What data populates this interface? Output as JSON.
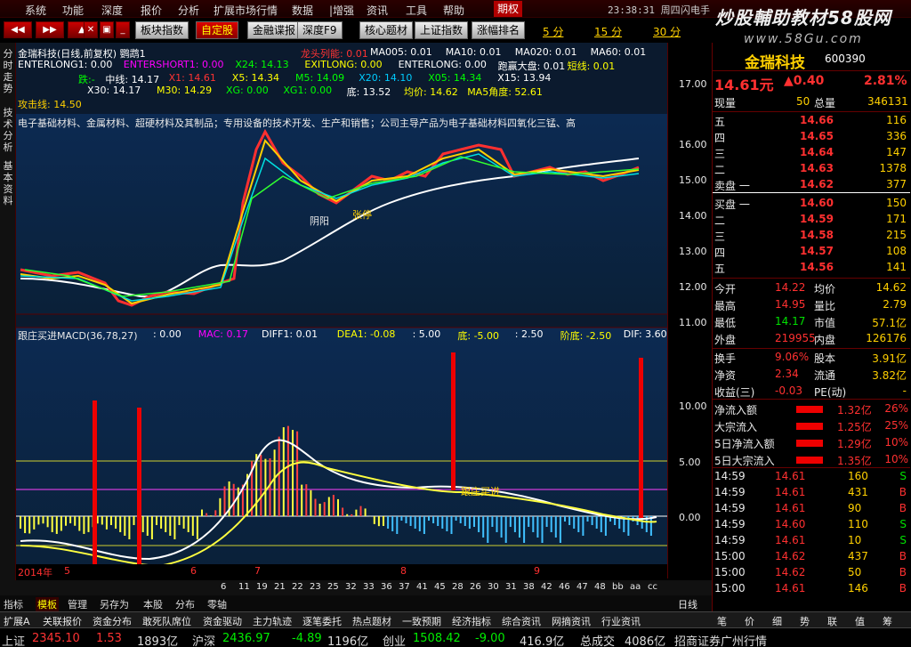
{
  "menu": {
    "items": [
      "系统",
      "功能",
      "深度",
      "报价",
      "分析",
      "扩展市场行情",
      "数据",
      "|增强",
      "资讯",
      "工具",
      "帮助"
    ],
    "active": "期权",
    "clock": "23:38:31 周四",
    "extra": "闪电手"
  },
  "brand": {
    "title": "炒股輔助教材58股网",
    "url": "www.58Gu.com"
  },
  "toolbar": {
    "buttons": [
      "板块指数",
      "自定股",
      "金融谍报",
      "深度F9",
      "核心题材",
      "上证指数",
      "涨幅排名"
    ],
    "periods": [
      "5 分",
      "15 分",
      "30 分"
    ]
  },
  "left_tabs": [
    "分时走势",
    "技术分析",
    "基本资料"
  ],
  "chart": {
    "title": "金瑞科技(日线,前复权) 鹦鹉1",
    "line1": [
      {
        "t": "ENTERLONG1: 0.00",
        "c": "#fff"
      },
      {
        "t": "ENTERSHORT1: 0.00",
        "c": "#f0f"
      },
      {
        "t": "X24: 14.13",
        "c": "#0f0"
      },
      {
        "t": "EXITLONG: 0.00",
        "c": "#ff0"
      },
      {
        "t": "ENTERLONG: 0.00",
        "c": "#fff"
      },
      {
        "t": "跑赢大盘: 0.01",
        "c": "#fff"
      },
      {
        "t": "短线: 0.01",
        "c": "#ff0"
      }
    ],
    "line0": [
      {
        "t": "龙头列能: 0.01",
        "c": "#f33"
      },
      {
        "t": "MA005: 0.01",
        "c": "#fff"
      },
      {
        "t": "MA10: 0.01",
        "c": "#fff"
      },
      {
        "t": "MA020: 0.01",
        "c": "#fff"
      },
      {
        "t": "MA60: 0.01",
        "c": "#fff"
      }
    ],
    "line2": [
      {
        "t": "跌:-",
        "c": "#0f0"
      },
      {
        "t": "中线: 14.17",
        "c": "#fff"
      },
      {
        "t": "X1: 14.61",
        "c": "#f33"
      },
      {
        "t": "X5: 14.34",
        "c": "#ff0"
      },
      {
        "t": "M5: 14.09",
        "c": "#0f0"
      },
      {
        "t": "X20: 14.10",
        "c": "#0cf"
      },
      {
        "t": "X05: 14.34",
        "c": "#0f0"
      },
      {
        "t": "X15: 13.94",
        "c": "#fff"
      }
    ],
    "line3": [
      {
        "t": "X30: 14.17",
        "c": "#fff"
      },
      {
        "t": "M30: 14.29",
        "c": "#ff0"
      },
      {
        "t": "XG: 0.00",
        "c": "#0f0"
      },
      {
        "t": "XG1: 0.00",
        "c": "#0f0"
      },
      {
        "t": "底: 13.52",
        "c": "#fff"
      },
      {
        "t": "均价: 14.62",
        "c": "#ff0"
      },
      {
        "t": "MA5角度: 52.61",
        "c": "#ff0"
      }
    ],
    "attack": "攻击线: 14.50",
    "ticker": "电子基础材料、金属材料、超硬材料及其制品；专用设备的技术开发、生产和销售；公司主导产品为电子基础材料四氧化三锰、高",
    "price_ticks": [
      "17.00",
      "16.00",
      "15.00",
      "14.00",
      "13.00",
      "12.00",
      "11.00"
    ],
    "macd_title": "跟庄买进MACD(36,78,27)",
    "macd_vals": [
      {
        "t": ": 0.00",
        "c": "#fff"
      },
      {
        "t": "MAC: 0.17",
        "c": "#f0f"
      },
      {
        "t": "DIFF1: 0.01",
        "c": "#fff"
      },
      {
        "t": "DEA1: -0.08",
        "c": "#ff0"
      },
      {
        "t": ": 5.00",
        "c": "#fff"
      },
      {
        "t": "底: -5.00",
        "c": "#ff0"
      },
      {
        "t": ": 2.50",
        "c": "#fff"
      },
      {
        "t": "阶底: -2.50",
        "c": "#ff0"
      },
      {
        "t": "DIF: 3.60",
        "c": "#fff"
      }
    ],
    "macd_ticks": [
      "10.00",
      "5.00",
      "0.00"
    ],
    "labels": [
      "阴阳",
      "张停",
      "跟庄买进"
    ],
    "date_axis": [
      "2014年",
      "5",
      "6",
      "7",
      "8",
      "9"
    ],
    "day_ticks": [
      "6",
      "11",
      "19",
      "21",
      "22",
      "23",
      "25",
      "32",
      "33",
      "36",
      "37",
      "41",
      "45",
      "28",
      "26",
      "30",
      "31",
      "38",
      "42",
      "46",
      "47",
      "48",
      "bb",
      "aa",
      "cc"
    ]
  },
  "bottom_tabs": [
    "指标",
    "模板",
    "管理",
    "另存为",
    "本股",
    "分布",
    "零轴"
  ],
  "bottom_tabs_right": "日线",
  "bottom_menu": [
    "扩展A",
    "关联报价",
    "资金分布",
    "敢死队席位",
    "资金驱动",
    "主力轨迹",
    "逐笔委托",
    "热点题材",
    "一致预期",
    "经济指标",
    "综合资讯",
    "网摘资讯",
    "行业资讯"
  ],
  "quote": {
    "name": "金瑞科技",
    "code": "600390",
    "price": "14.61元",
    "change": "▲0.40",
    "pct": "2.81%",
    "now_label": "现量",
    "now": "50",
    "total_label": "总量",
    "total": "346131",
    "sells": [
      {
        "l": "五",
        "p": "14.66",
        "v": "116"
      },
      {
        "l": "四",
        "p": "14.65",
        "v": "336"
      },
      {
        "l": "三",
        "p": "14.64",
        "v": "147"
      },
      {
        "l": "二",
        "p": "14.63",
        "v": "1378"
      },
      {
        "l": "卖盘 一",
        "p": "14.62",
        "v": "377"
      }
    ],
    "buys": [
      {
        "l": "买盘 一",
        "p": "14.60",
        "v": "150"
      },
      {
        "l": "二",
        "p": "14.59",
        "v": "171"
      },
      {
        "l": "三",
        "p": "14.58",
        "v": "215"
      },
      {
        "l": "四",
        "p": "14.57",
        "v": "108"
      },
      {
        "l": "五",
        "p": "14.56",
        "v": "141"
      }
    ],
    "stats": [
      {
        "a": "今开",
        "b": "14.22",
        "c": "均价",
        "d": "14.62"
      },
      {
        "a": "最高",
        "b": "14.95",
        "c": "量比",
        "d": "2.79"
      },
      {
        "a": "最低",
        "b": "14.17",
        "c": "市值",
        "d": "57.1亿"
      },
      {
        "a": "外盘",
        "b": "219955",
        "c": "内盘",
        "d": "126176"
      }
    ],
    "stats2": [
      {
        "a": "换手",
        "b": "9.06%",
        "c": "股本",
        "d": "3.91亿"
      },
      {
        "a": "净资",
        "b": "2.34",
        "c": "流通",
        "d": "3.82亿"
      },
      {
        "a": "收益(三)",
        "b": "-0.03",
        "c": "PE(动)",
        "d": "-"
      }
    ],
    "flows": [
      {
        "a": "净流入额",
        "b": "1.32亿",
        "c": "26%"
      },
      {
        "a": "大宗流入",
        "b": "1.25亿",
        "c": "25%"
      },
      {
        "a": "5日净流入额",
        "b": "1.29亿",
        "c": "10%"
      },
      {
        "a": "5日大宗流入",
        "b": "1.35亿",
        "c": "10%"
      }
    ],
    "trades": [
      {
        "t": "14:59",
        "p": "14.61",
        "v": "160",
        "s": "S"
      },
      {
        "t": "14:59",
        "p": "14.61",
        "v": "431",
        "s": "B"
      },
      {
        "t": "14:59",
        "p": "14.61",
        "v": "90",
        "s": "B"
      },
      {
        "t": "14:59",
        "p": "14.60",
        "v": "110",
        "s": "S"
      },
      {
        "t": "14:59",
        "p": "14.61",
        "v": "10",
        "s": "S"
      },
      {
        "t": "15:00",
        "p": "14.62",
        "v": "437",
        "s": "B"
      },
      {
        "t": "15:00",
        "p": "14.62",
        "v": "50",
        "s": "B"
      },
      {
        "t": "15:00",
        "p": "14.61",
        "v": "146",
        "s": "B"
      }
    ],
    "tabs": [
      "笔",
      "价",
      "细",
      "势",
      "联",
      "值",
      "筹"
    ]
  },
  "status": {
    "items": [
      {
        "t": "上证",
        "c": "#ddd"
      },
      {
        "t": "2345.10",
        "c": "#f33"
      },
      {
        "t": "1.53",
        "c": "#f33"
      },
      {
        "t": "1893亿",
        "c": "#ddd"
      },
      {
        "t": "沪深",
        "c": "#ddd"
      },
      {
        "t": "2436.97",
        "c": "#0e0"
      },
      {
        "t": "-4.89",
        "c": "#0e0"
      },
      {
        "t": "1196亿",
        "c": "#ddd"
      },
      {
        "t": "创业",
        "c": "#ddd"
      },
      {
        "t": "1508.42",
        "c": "#0e0"
      },
      {
        "t": "-9.00",
        "c": "#0e0"
      },
      {
        "t": "416.9亿",
        "c": "#ddd"
      },
      {
        "t": "总成交",
        "c": "#ddd"
      },
      {
        "t": "4086亿",
        "c": "#ddd"
      },
      {
        "t": "招商证券广州行情",
        "c": "#ddd"
      }
    ]
  }
}
